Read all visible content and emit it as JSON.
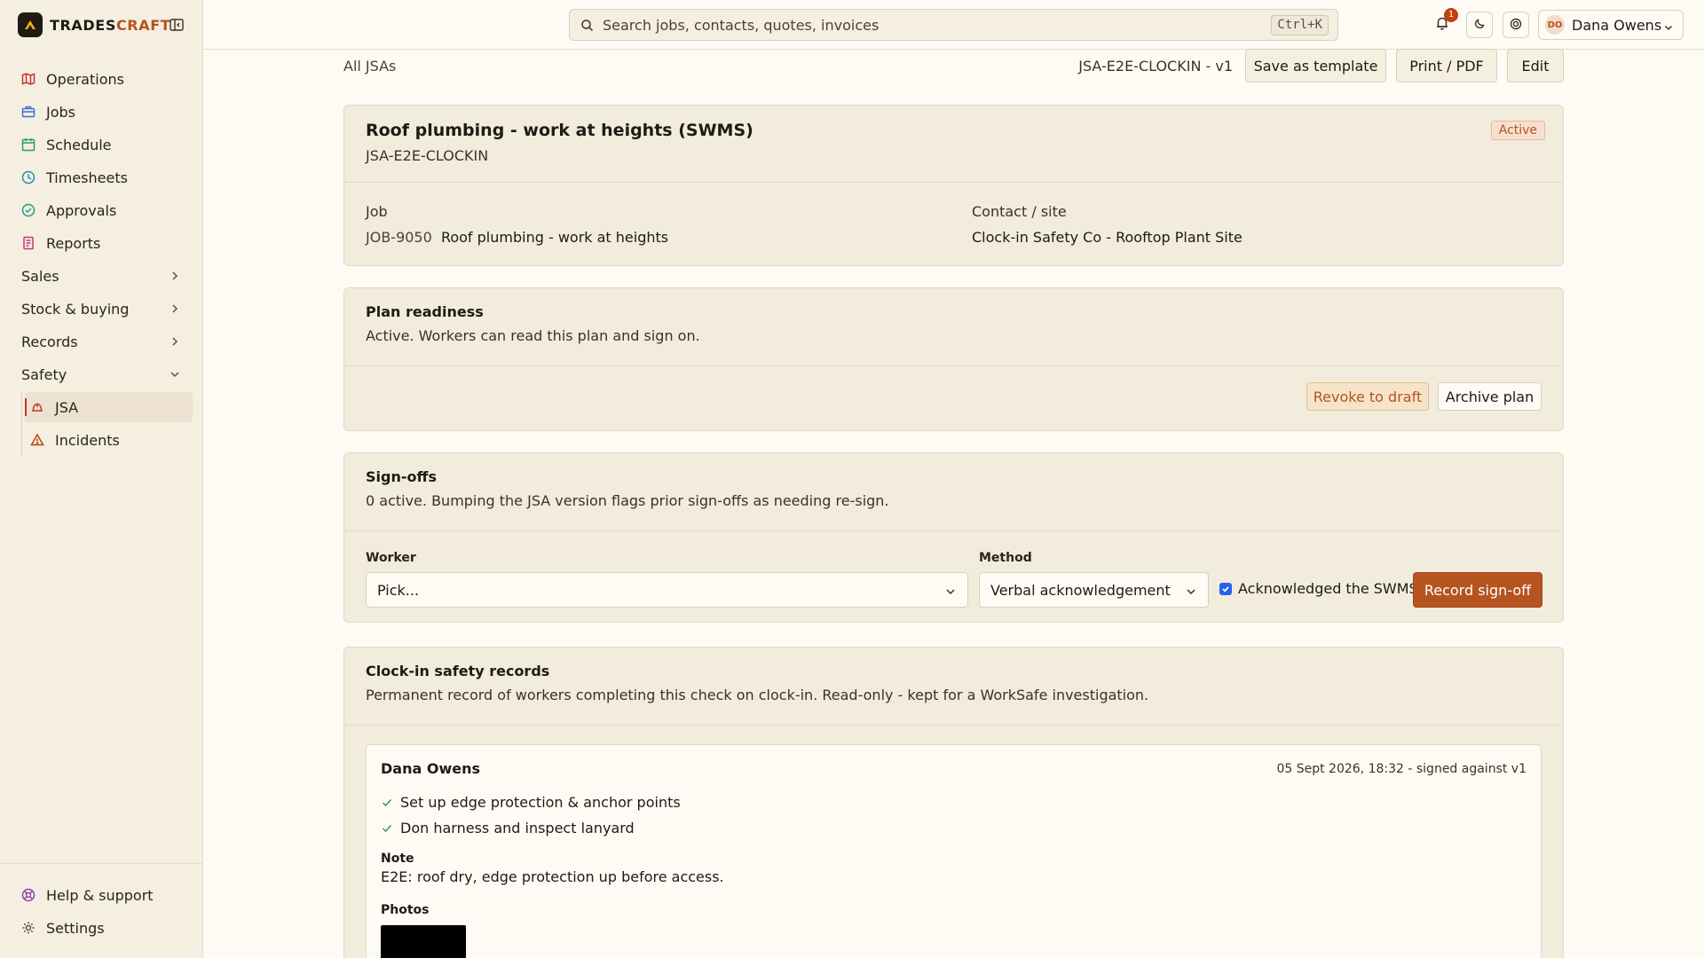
{
  "brand": {
    "name_left": "TRADES",
    "name_right": "CRAFT"
  },
  "sidebar": {
    "items": [
      {
        "label": "Operations",
        "icon": "map-icon"
      },
      {
        "label": "Jobs",
        "icon": "briefcase-icon"
      },
      {
        "label": "Schedule",
        "icon": "calendar-icon"
      },
      {
        "label": "Timesheets",
        "icon": "clock-icon"
      },
      {
        "label": "Approvals",
        "icon": "check-circle-icon"
      },
      {
        "label": "Reports",
        "icon": "report-icon"
      }
    ],
    "groups": [
      {
        "label": "Sales"
      },
      {
        "label": "Stock & buying"
      },
      {
        "label": "Records"
      },
      {
        "label": "Safety"
      }
    ],
    "safety_items": [
      {
        "label": "JSA",
        "icon": "hardhat-icon"
      },
      {
        "label": "Incidents",
        "icon": "warning-icon"
      }
    ],
    "bottom": [
      {
        "label": "Help & support",
        "icon": "lifebuoy-icon"
      },
      {
        "label": "Settings",
        "icon": "gear-icon"
      }
    ]
  },
  "topbar": {
    "search_placeholder": "Search jobs, contacts, quotes, invoices",
    "search_shortcut": "Ctrl+K",
    "notification_count": "1",
    "user_initials": "DO",
    "user_name": "Dana Owens"
  },
  "header": {
    "breadcrumb": "All JSAs",
    "doc_id": "JSA-E2E-CLOCKIN - v1",
    "save_template": "Save as template",
    "print_pdf": "Print / PDF",
    "edit": "Edit"
  },
  "summary": {
    "title": "Roof plumbing - work at heights (SWMS)",
    "code": "JSA-E2E-CLOCKIN",
    "status": "Active",
    "job_label": "Job",
    "job_number": "JOB-9050",
    "job_name": "Roof plumbing - work at heights",
    "contact_label": "Contact / site",
    "contact_value": "Clock-in Safety Co - Rooftop Plant Site"
  },
  "readiness": {
    "title": "Plan readiness",
    "text": "Active. Workers can read this plan and sign on.",
    "revoke": "Revoke to draft",
    "archive": "Archive plan"
  },
  "signoffs": {
    "title": "Sign-offs",
    "text": "0 active. Bumping the JSA version flags prior sign-offs as needing re-sign.",
    "worker_label": "Worker",
    "worker_value": "Pick...",
    "method_label": "Method",
    "method_value": "Verbal acknowledgement",
    "ack_label": "Acknowledged the SWMS",
    "record_btn": "Record sign-off"
  },
  "clockin": {
    "title": "Clock-in safety records",
    "text": "Permanent record of workers completing this check on clock-in. Read-only - kept for a WorkSafe investigation.",
    "record": {
      "name": "Dana Owens",
      "meta": "05 Sept 2026, 18:32 - signed against v1",
      "checks": [
        "Set up edge protection & anchor points",
        "Don harness and inspect lanyard"
      ],
      "note_label": "Note",
      "note": "E2E: roof dry, edge protection up before access.",
      "photos_label": "Photos"
    }
  }
}
